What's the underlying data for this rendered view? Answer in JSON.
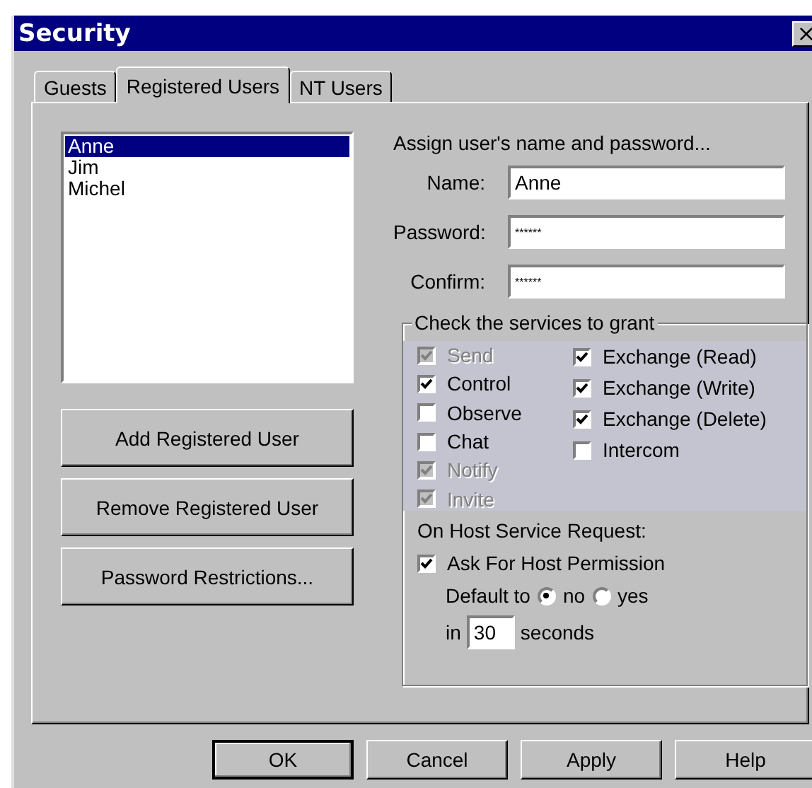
{
  "window": {
    "title": "Security",
    "close": "×"
  },
  "tabs": [
    {
      "label": "Guests",
      "selected": false
    },
    {
      "label": "Registered Users",
      "selected": true
    },
    {
      "label": "NT Users",
      "selected": false
    }
  ],
  "users": [
    {
      "name": "Anne",
      "selected": true
    },
    {
      "name": "Jim",
      "selected": false
    },
    {
      "name": "Michel",
      "selected": false
    }
  ],
  "user_buttons": [
    "Add Registered User",
    "Remove Registered User",
    "Password Restrictions..."
  ],
  "assign_heading": "Assign user's name and password...",
  "fields": [
    {
      "label": "Name:",
      "value": "Anne"
    },
    {
      "label": "Password:",
      "value": "******"
    },
    {
      "label": "Confirm:",
      "value": "******"
    }
  ],
  "services": {
    "title": "Check the services to grant",
    "columns": [
      [
        {
          "label": "Send",
          "checked": true,
          "disabled": true
        },
        {
          "label": "Control",
          "checked": true,
          "disabled": false
        },
        {
          "label": "Observe",
          "checked": false,
          "disabled": false
        },
        {
          "label": "Chat",
          "checked": false,
          "disabled": false
        },
        {
          "label": "Notify",
          "checked": true,
          "disabled": true
        },
        {
          "label": "Invite",
          "checked": true,
          "disabled": true
        }
      ],
      [
        {
          "label": "Exchange (Read)",
          "checked": true,
          "disabled": false
        },
        {
          "label": "Exchange (Write)",
          "checked": true,
          "disabled": false
        },
        {
          "label": "Exchange (Delete)",
          "checked": true,
          "disabled": false
        },
        {
          "label": "Intercom",
          "checked": false,
          "disabled": false
        }
      ]
    ]
  },
  "host_request": {
    "heading": "On Host Service Request:",
    "ask": {
      "label": "Ask For Host Permission",
      "checked": true
    },
    "default_label": "Default to",
    "options": [
      {
        "label": "no",
        "selected": true
      },
      {
        "label": "yes",
        "selected": false
      }
    ],
    "timeout_prefix": "in",
    "timeout_value": "30",
    "timeout_suffix": "seconds"
  },
  "buttons": [
    {
      "label": "OK",
      "default": true
    },
    {
      "label": "Cancel",
      "default": false
    },
    {
      "label": "Apply",
      "default": false
    },
    {
      "label": "Help",
      "default": false
    }
  ]
}
